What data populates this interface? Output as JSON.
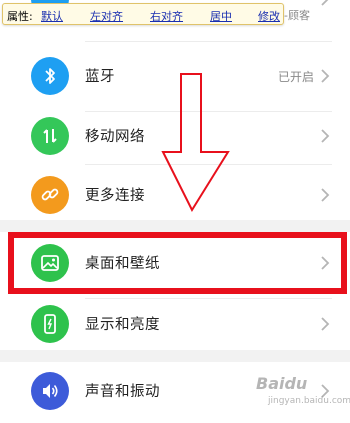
{
  "toolbar": {
    "prefix": "属性:",
    "links": [
      "默认",
      "左对齐",
      "右对齐",
      "居中",
      "修改"
    ]
  },
  "top_partial_value": "-顾客",
  "settings": {
    "items": [
      {
        "label": "蓝牙",
        "value": "已开启",
        "icon": "bluetooth-icon",
        "color": "#1e9ff2"
      },
      {
        "label": "移动网络",
        "value": "",
        "icon": "mobile-network-icon",
        "color": "#34c759"
      },
      {
        "label": "更多连接",
        "value": "",
        "icon": "link-icon",
        "color": "#f39a1d"
      },
      {
        "label": "桌面和壁纸",
        "value": "",
        "icon": "wallpaper-icon",
        "color": "#2ec24c"
      },
      {
        "label": "显示和亮度",
        "value": "",
        "icon": "display-brightness-icon",
        "color": "#2ec24c"
      },
      {
        "label": "声音和振动",
        "value": "",
        "icon": "sound-icon",
        "color": "#3d5bd9"
      }
    ]
  },
  "annotation": {
    "color": "#e8101c"
  },
  "watermark": {
    "brand": "Baidu",
    "sub": "jingyan.baidu.com"
  }
}
